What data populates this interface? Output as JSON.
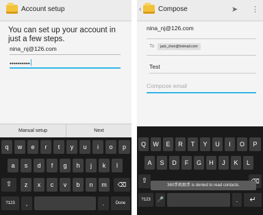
{
  "left": {
    "title": "Account setup",
    "heading": "You can set up your account in just a few steps.",
    "email_value": "nina_nj@126.com",
    "password_value": "••••••••••",
    "manual_setup_label": "Manual setup",
    "next_label": "Next",
    "keyboard": {
      "row1": [
        "q",
        "w",
        "e",
        "r",
        "t",
        "y",
        "u",
        "i",
        "o",
        "p"
      ],
      "row2": [
        "a",
        "s",
        "d",
        "f",
        "g",
        "h",
        "j",
        "k",
        "l"
      ],
      "row3": [
        "z",
        "x",
        "c",
        "v",
        "b",
        "n",
        "m"
      ],
      "symbols_label": "?123",
      "comma_label": ",",
      "period_label": ".",
      "done_label": "Done"
    }
  },
  "right": {
    "title": "Compose",
    "from_value": "nina_nj@126.com",
    "to_label": "To",
    "to_chip": "jack_chen@hotmail.com",
    "subject_value": "Test",
    "compose_placeholder": "Compose email",
    "keyboard": {
      "row1": [
        "Q",
        "W",
        "E",
        "R",
        "T",
        "Y",
        "U",
        "I",
        "O",
        "P"
      ],
      "row2": [
        "A",
        "S",
        "D",
        "F",
        "G",
        "H",
        "J",
        "K",
        "L"
      ],
      "symbols_label": "?123",
      "comma_label": ",",
      "period_label": "."
    },
    "toast_text": "360手机助手 is denied to read contacts."
  },
  "icons": {
    "app": "mail-app-icon",
    "back": "back-chevron-icon",
    "send": "send-icon",
    "overflow": "overflow-menu-icon",
    "shift": "shift-icon",
    "backspace": "backspace-icon",
    "mic": "microphone-icon",
    "enter": "enter-icon"
  },
  "colors": {
    "accent": "#33b5e5",
    "keyboard_bg": "#1a1a1a",
    "key_bg": "#3e3e3e"
  }
}
